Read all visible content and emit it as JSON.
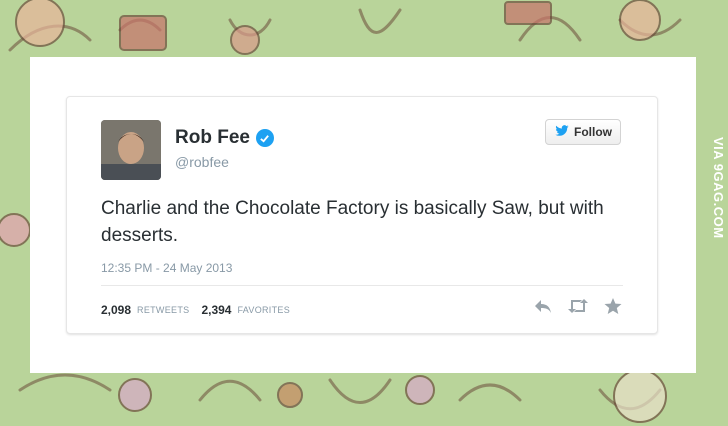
{
  "tweet": {
    "name": "Rob Fee",
    "handle": "@robfee",
    "follow_label": "Follow",
    "text": "Charlie and the Chocolate Factory is basically Saw, but with desserts.",
    "timestamp": "12:35 PM - 24 May 2013",
    "retweets_count": "2,098",
    "retweets_label": "RETWEETS",
    "favorites_count": "2,394",
    "favorites_label": "FAVORITES"
  },
  "watermark": "VIA 9GAG.COM",
  "icons": {
    "verified": "verified-badge-icon",
    "follow": "twitter-bird-icon",
    "reply": "reply-icon",
    "retweet": "retweet-icon",
    "favorite": "star-icon"
  },
  "colors": {
    "background": "#b9d49a",
    "accent": "#1da1f2",
    "text": "#292f33",
    "muted": "#8899a6"
  }
}
